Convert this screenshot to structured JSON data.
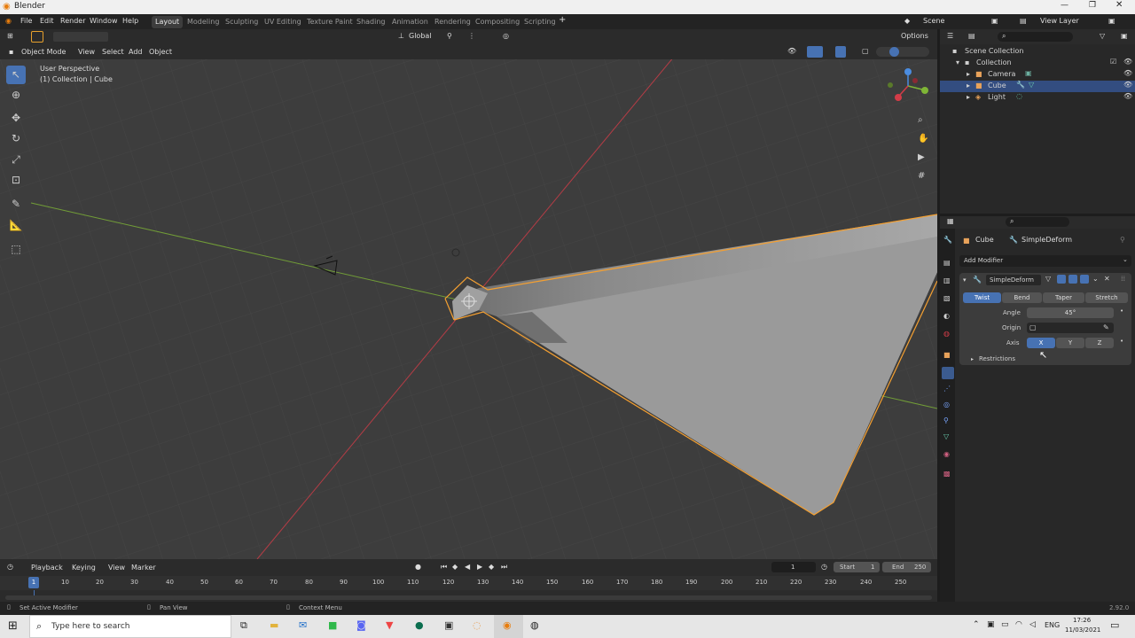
{
  "title": "Blender",
  "menu": [
    "File",
    "Edit",
    "Render",
    "Window",
    "Help"
  ],
  "workspaces": [
    "Layout",
    "Modeling",
    "Sculpting",
    "UV Editing",
    "Texture Paint",
    "Shading",
    "Animation",
    "Rendering",
    "Compositing",
    "Scripting"
  ],
  "scene": "Scene",
  "view_layer": "View Layer",
  "toolbar": {
    "transform": "Global",
    "options": "Options"
  },
  "viewport_header": {
    "mode": "Object Mode",
    "items": [
      "View",
      "Select",
      "Add",
      "Object"
    ]
  },
  "viewport": {
    "perspective": "User Perspective",
    "collection": "(1) Collection | Cube"
  },
  "outliner": {
    "root": "Scene Collection",
    "collection": "Collection",
    "objects": [
      "Camera",
      "Cube",
      "Light"
    ]
  },
  "properties": {
    "object": "Cube",
    "modifier_breadcrumb": "SimpleDeform",
    "add_modifier": "Add Modifier",
    "modifier_name": "SimpleDeform",
    "modes": [
      "Twist",
      "Bend",
      "Taper",
      "Stretch"
    ],
    "active_mode": "Twist",
    "angle_label": "Angle",
    "angle_value": "45°",
    "origin_label": "Origin",
    "axis_label": "Axis",
    "axes": [
      "X",
      "Y",
      "Z"
    ],
    "active_axis": "X",
    "restrictions": "Restrictions"
  },
  "timeline": {
    "menus": [
      "Playback",
      "Keying",
      "View",
      "Marker"
    ],
    "current": "1",
    "start_label": "Start",
    "start": "1",
    "end_label": "End",
    "end": "250",
    "ticks": [
      "1",
      "10",
      "20",
      "30",
      "40",
      "50",
      "60",
      "70",
      "80",
      "90",
      "100",
      "110",
      "120",
      "130",
      "140",
      "150",
      "160",
      "170",
      "180",
      "190",
      "200",
      "210",
      "220",
      "230",
      "240",
      "250"
    ]
  },
  "status": {
    "left": "Set Active Modifier",
    "mid": "Pan View",
    "right": "Context Menu",
    "version": "2.92.0"
  },
  "taskbar": {
    "search_placeholder": "Type here to search",
    "lang": "ENG",
    "time": "17:26",
    "date": "11/03/2021"
  },
  "colors": {
    "accent": "#4772b3",
    "selection_outline": "#f5a031",
    "x_axis": "#d33c48",
    "y_axis": "#7fb536"
  }
}
